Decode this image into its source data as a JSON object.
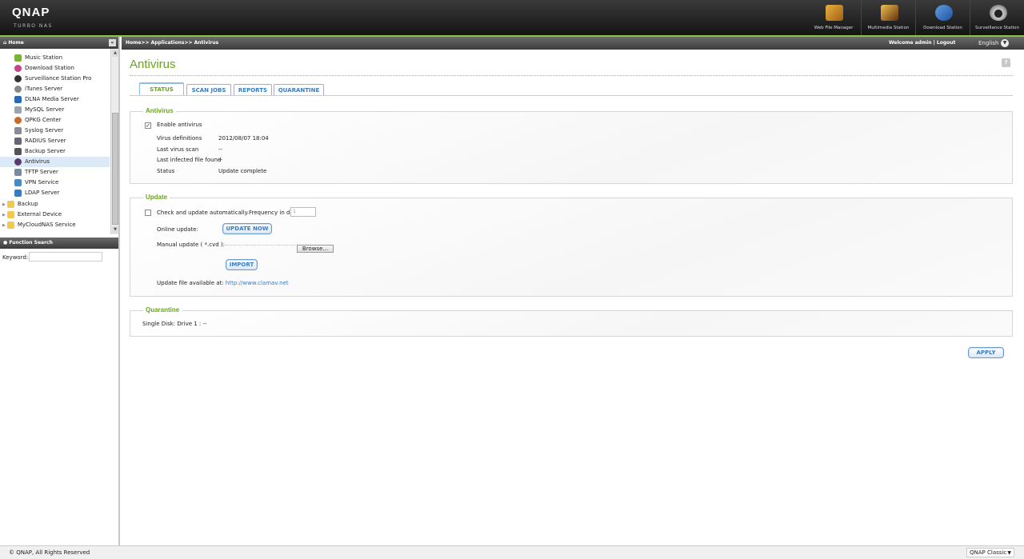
{
  "header": {
    "logo": "QNAP",
    "logo_sub": "TURBO NAS",
    "apps": [
      {
        "label": "Web File Manager",
        "icon": "web-file-manager-icon"
      },
      {
        "label": "Multimedia Station",
        "icon": "multimedia-station-icon"
      },
      {
        "label": "Download Station",
        "icon": "download-station-icon"
      },
      {
        "label": "Surveillance Station",
        "icon": "surveillance-station-icon"
      }
    ]
  },
  "sidebar": {
    "title": "Home",
    "items": [
      {
        "label": "Music Station",
        "color": "#7bb33a"
      },
      {
        "label": "Download Station",
        "color": "#c74488"
      },
      {
        "label": "Surveillance Station Pro",
        "color": "#333333"
      },
      {
        "label": "iTunes Server",
        "color": "#888888"
      },
      {
        "label": "DLNA Media Server",
        "color": "#2a6ab0"
      },
      {
        "label": "MySQL Server",
        "color": "#9aa4b0"
      },
      {
        "label": "QPKG Center",
        "color": "#c86a2a"
      },
      {
        "label": "Syslog Server",
        "color": "#8a8a9a"
      },
      {
        "label": "RADIUS Server",
        "color": "#666677"
      },
      {
        "label": "Backup Server",
        "color": "#555555"
      },
      {
        "label": "Antivirus",
        "color": "#5a3a6a",
        "selected": true
      },
      {
        "label": "TFTP Server",
        "color": "#7a8aa0"
      },
      {
        "label": "VPN Service",
        "color": "#4a8ac0"
      },
      {
        "label": "LDAP Server",
        "color": "#3a7ac0"
      }
    ],
    "folders": [
      "Backup",
      "External Device",
      "MyCloudNAS Service"
    ],
    "function_search": "Function Search",
    "keyword_label": "Keyword:"
  },
  "topbar": {
    "breadcrumb": "Home>> Applications>> Antivirus",
    "welcome": "Welcome admin | Logout",
    "language": "English"
  },
  "main": {
    "title": "Antivirus",
    "tabs": [
      "STATUS",
      "SCAN JOBS",
      "REPORTS",
      "QUARANTINE"
    ],
    "active_tab": "STATUS",
    "antivirus": {
      "legend": "Antivirus",
      "enable_label": "Enable antivirus",
      "enabled": true,
      "rows": [
        {
          "label": "Virus definitions",
          "value": "2012/08/07 18:04"
        },
        {
          "label": "Last virus scan",
          "value": "--"
        },
        {
          "label": "Last infected file found",
          "value": "--"
        },
        {
          "label": "Status",
          "value": "Update complete"
        }
      ]
    },
    "update": {
      "legend": "Update",
      "auto_label": "Check and update automatically.Frequency in days:",
      "auto_checked": false,
      "frequency": "1",
      "online_label": "Online update:",
      "update_now": "UPDATE NOW",
      "manual_label": "Manual update ( *.cvd ):",
      "browse": "Browse...",
      "import": "IMPORT",
      "available_label": "Update file available at:",
      "available_link": "http://www.clamav.net"
    },
    "quarantine": {
      "legend": "Quarantine",
      "text": "Single Disk: Drive 1 : --"
    },
    "apply": "APPLY"
  },
  "footer": {
    "copyright": "© QNAP, All Rights Reserved",
    "theme": "QNAP Classic"
  }
}
